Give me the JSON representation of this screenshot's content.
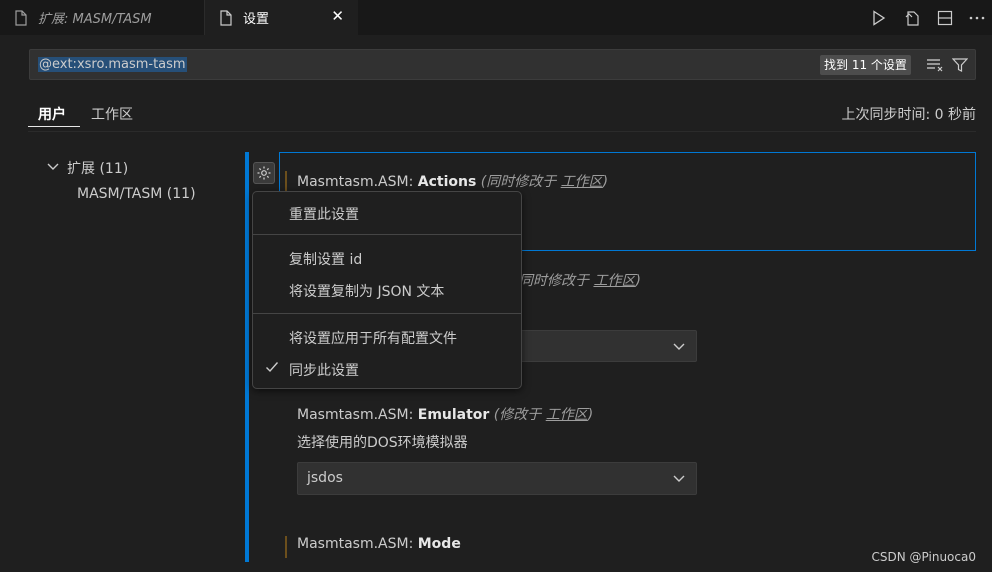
{
  "tabs": [
    {
      "label": "扩展: MASM/TASM"
    },
    {
      "label": "设置"
    }
  ],
  "search": {
    "value": "@ext:xsro.masm-tasm",
    "result_count": "找到 11 个设置"
  },
  "scope_tabs": [
    {
      "label": "用户"
    },
    {
      "label": "工作区"
    }
  ],
  "sync_status": "上次同步时间: 0 秒前",
  "tree": {
    "group": "扩展 (11)",
    "child": "MASM/TASM (11)"
  },
  "settings": {
    "actions": {
      "prefix": "Masmtasm.ASM: ",
      "name": "Actions",
      "note": "(同时修改于 ",
      "scope_link": "工作区",
      "note_end": ")"
    },
    "second": {
      "note": "同时修改于 ",
      "scope_link": "工作区",
      "note_end": ")"
    },
    "emulator": {
      "prefix": "Masmtasm.ASM: ",
      "name": "Emulator",
      "note": "(修改于 ",
      "scope_link": "工作区",
      "note_end": ")",
      "description": "选择使用的DOS环境模拟器",
      "value": "jsdos"
    },
    "mode": {
      "prefix": "Masmtasm.ASM: ",
      "name": "Mode"
    }
  },
  "context_menu": {
    "reset": "重置此设置",
    "copy_id": "复制设置 id",
    "copy_json": "将设置复制为 JSON 文本",
    "apply_all": "将设置应用于所有配置文件",
    "sync": "同步此设置"
  },
  "watermark": "CSDN @Pinuoca0",
  "colors": {
    "accent": "#0078d4",
    "background": "#1f1f1f",
    "modified_marker": "#6c4f1c"
  }
}
